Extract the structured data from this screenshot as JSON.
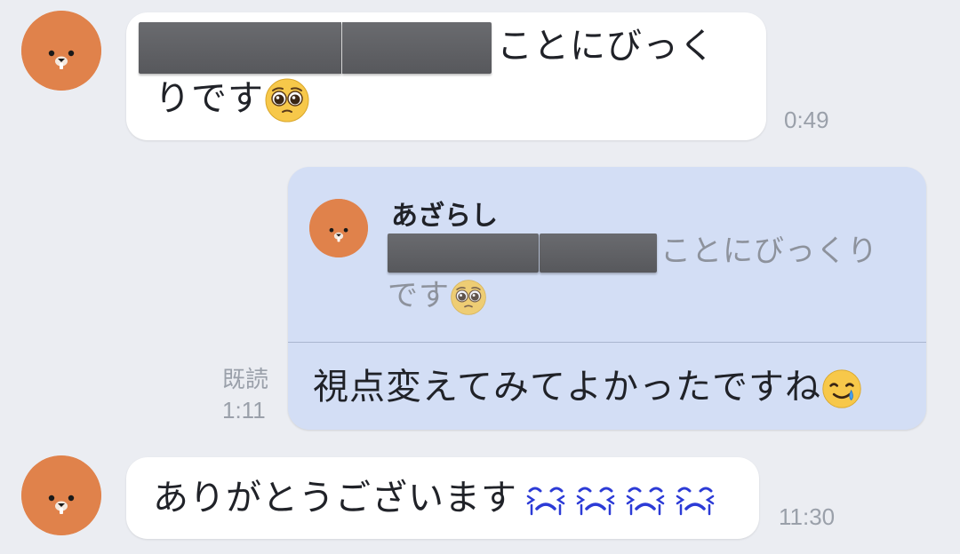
{
  "messages": [
    {
      "sender": "other",
      "line1_suffix": "ことにびっく",
      "line2_prefix": "りです",
      "emoji": "pleading-face-emoji",
      "time": "0:49"
    },
    {
      "sender": "self",
      "reply": {
        "name": "あざらし",
        "line1_suffix": "ことにびっくり",
        "line2_prefix": "です",
        "emoji": "pleading-face-emoji"
      },
      "text": "視点変えてみてよかったですね",
      "emoji": "smiling-face-with-tear-emoji",
      "read_label": "既読",
      "time": "1:11"
    },
    {
      "sender": "other",
      "text": "ありがとうございます",
      "emojis": [
        "crying-face-emoji",
        "crying-face-emoji",
        "crying-face-emoji",
        "crying-face-emoji"
      ],
      "time": "11:30"
    }
  ],
  "colors": {
    "background": "#ebedf2",
    "incoming_bubble": "#ffffff",
    "outgoing_bubble": "#d3def5",
    "avatar": "#e0824b",
    "time_text": "#9aa0aa",
    "crying_emoji": "#2c3bd6"
  }
}
